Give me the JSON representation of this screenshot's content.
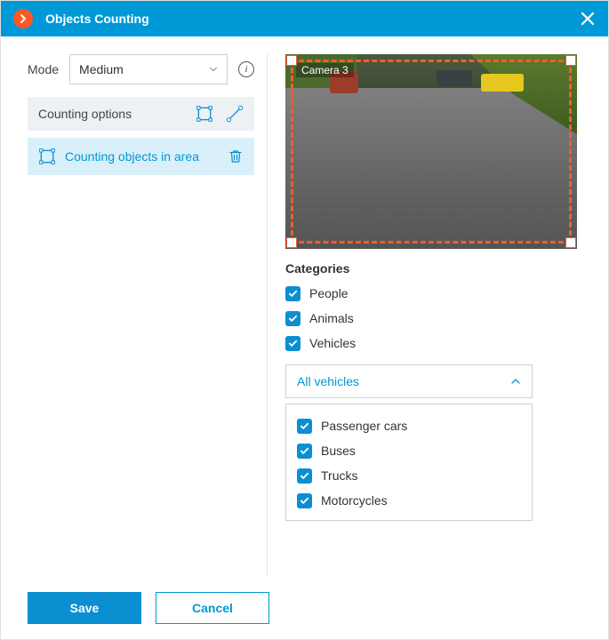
{
  "dialog": {
    "title": "Objects Counting"
  },
  "mode": {
    "label": "Mode",
    "value": "Medium"
  },
  "sidebar": {
    "section_title": "Counting options",
    "active_item": "Counting objects in area"
  },
  "preview": {
    "camera_label": "Camera 3"
  },
  "categories": {
    "title": "Categories",
    "items": [
      {
        "label": "People",
        "checked": true
      },
      {
        "label": "Animals",
        "checked": true
      },
      {
        "label": "Vehicles",
        "checked": true
      }
    ]
  },
  "vehicles_dropdown": {
    "label": "All vehicles",
    "expanded": true,
    "options": [
      {
        "label": "Passenger cars",
        "checked": true
      },
      {
        "label": "Buses",
        "checked": true
      },
      {
        "label": "Trucks",
        "checked": true
      },
      {
        "label": "Motorcycles",
        "checked": true
      }
    ]
  },
  "buttons": {
    "save": "Save",
    "cancel": "Cancel"
  },
  "colors": {
    "accent": "#0099d8",
    "selection_box": "#ff5c22"
  }
}
